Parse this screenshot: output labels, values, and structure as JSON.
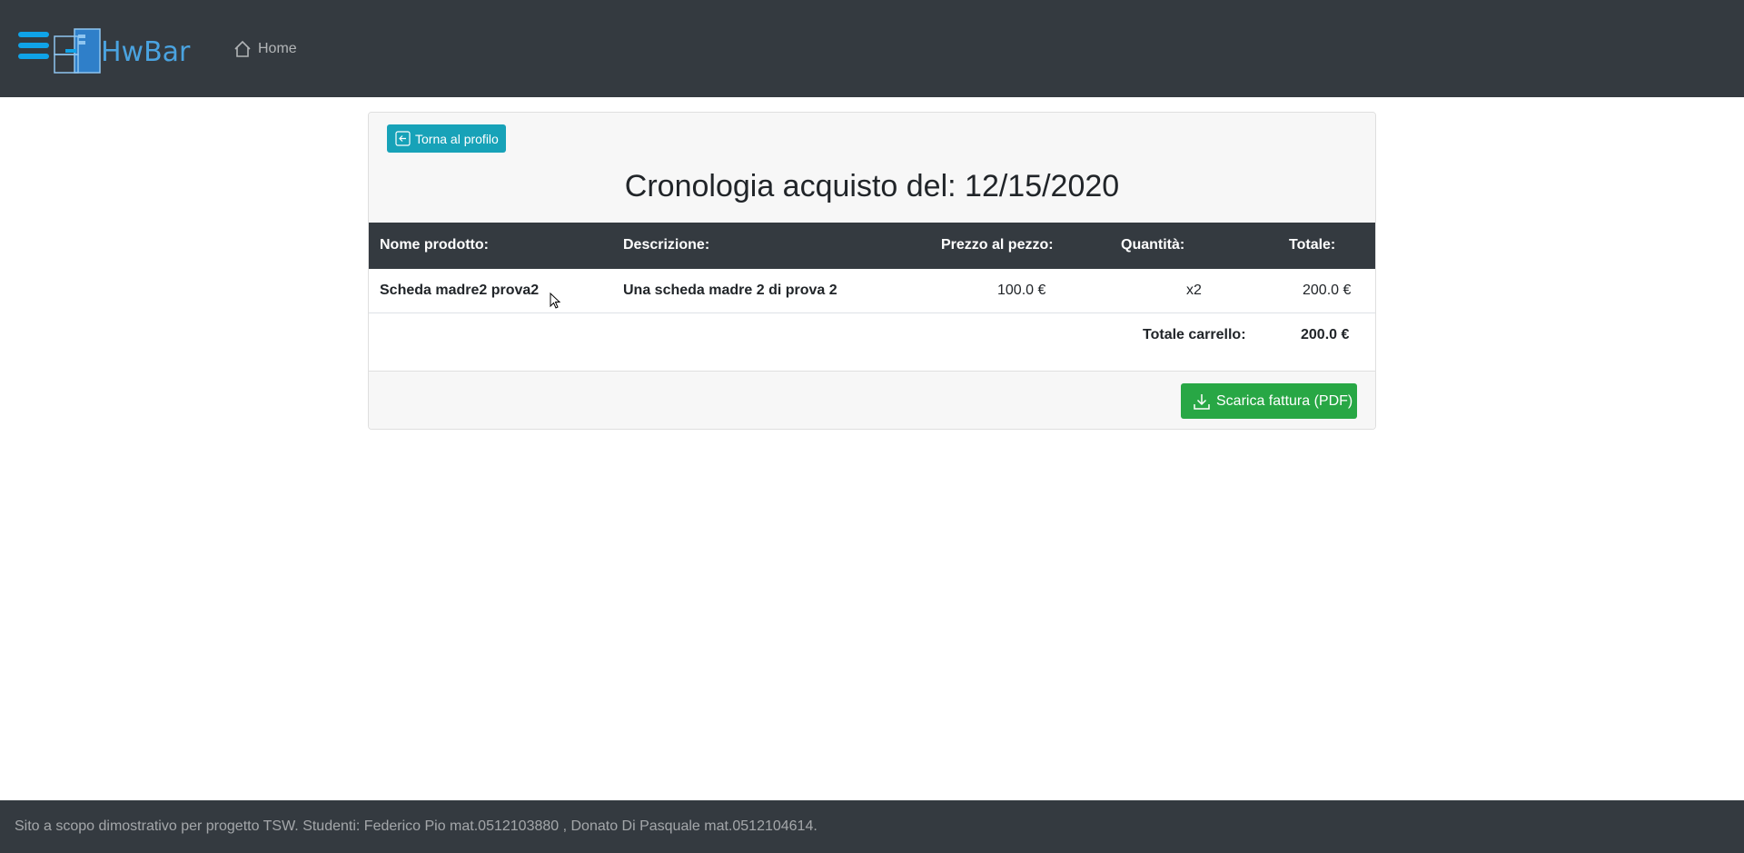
{
  "navbar": {
    "brand": "HwBar",
    "home_label": "Home",
    "colors": {
      "background": "#343a40",
      "brand": "#4aa3e0",
      "hamburger": "#0fa3e8"
    }
  },
  "card": {
    "back_button": "Torna al profilo",
    "title": "Cronologia acquisto del: 12/15/2020",
    "table": {
      "headers": [
        "Nome prodotto:",
        "Descrizione:",
        "Prezzo al pezzo:",
        "Quantità:",
        "Totale:"
      ],
      "rows": [
        {
          "name": "Scheda madre2 prova2",
          "description": "Una scheda madre 2 di prova 2",
          "unit_price": "100.0 €",
          "quantity": "x2",
          "total": "200.0 €"
        }
      ],
      "cart_total_label": "Totale carrello:",
      "cart_total_value": "200.0 €"
    },
    "download_button": "Scarica fattura (PDF)",
    "colors": {
      "back_button": "#17a2b8",
      "download_button": "#28a745",
      "table_header": "#343a40"
    }
  },
  "footer": {
    "text": "Sito a scopo dimostrativo per progetto TSW. Studenti: Federico Pio mat.0512103880 , Donato Di Pasquale mat.0512104614."
  }
}
